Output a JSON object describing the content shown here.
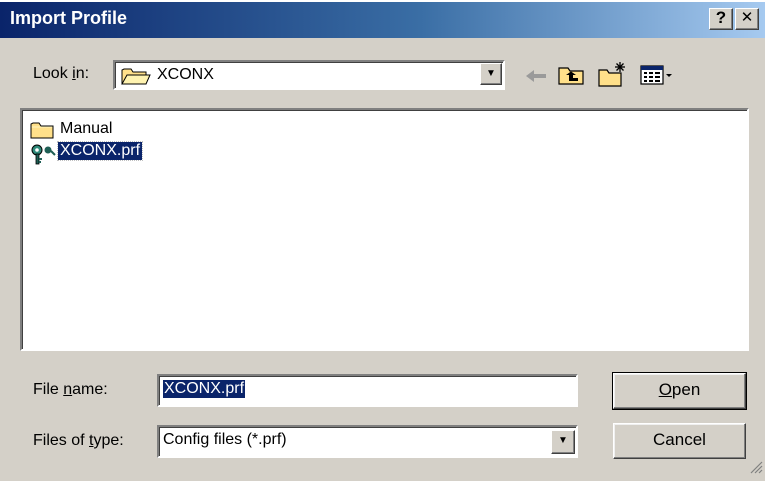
{
  "window": {
    "title": "Import Profile",
    "help_label": "?",
    "close_label": "✕"
  },
  "look_in": {
    "label_pre": "Look ",
    "label_key": "i",
    "label_post": "n:",
    "value": "XCONX"
  },
  "toolbar": {
    "icons": [
      "back-arrow-icon",
      "up-one-level-icon",
      "new-folder-icon",
      "view-menu-icon"
    ]
  },
  "files": [
    {
      "name": "Manual",
      "icon": "folder-icon",
      "selected": false
    },
    {
      "name": "XCONX.prf",
      "icon": "key-file-icon",
      "selected": true
    }
  ],
  "file_name": {
    "label_pre": "File ",
    "label_key": "n",
    "label_post": "ame:",
    "value": "XCONX.prf"
  },
  "file_type": {
    "label_pre": "Files of ",
    "label_key": "t",
    "label_post": "ype:",
    "value": "Config files (*.prf)"
  },
  "buttons": {
    "open_key": "O",
    "open_rest": "pen",
    "cancel": "Cancel"
  },
  "colors": {
    "title_gradient_start": "#0a246a",
    "title_gradient_end": "#a6caf0",
    "face": "#d4d0c8",
    "selection": "#0a246a"
  }
}
